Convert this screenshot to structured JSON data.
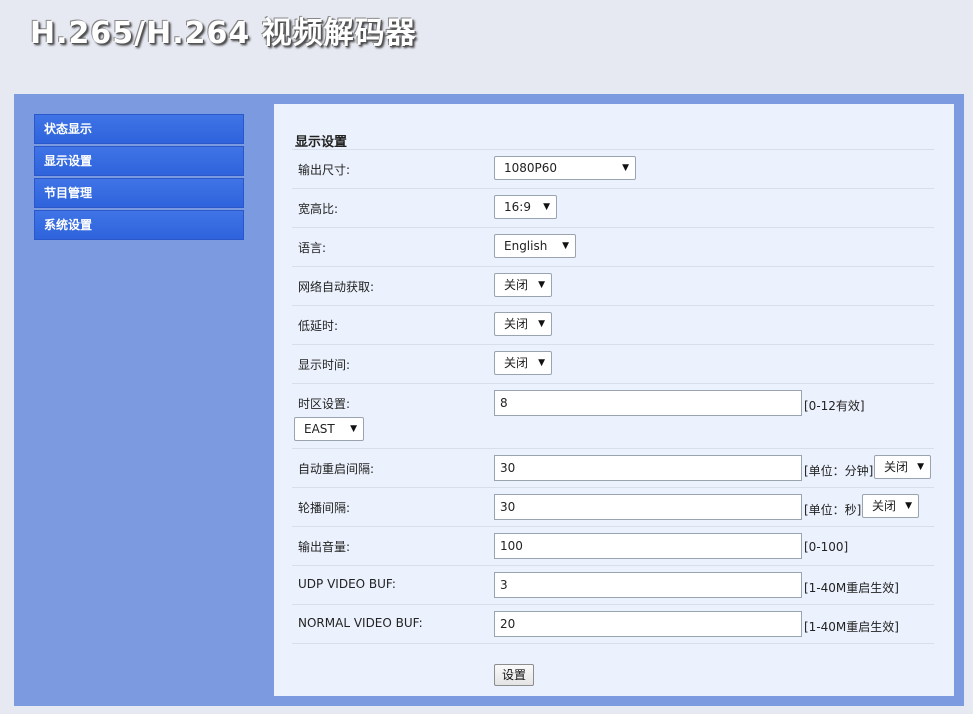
{
  "header": {
    "title": "H.265/H.264 视频解码器"
  },
  "sidebar": {
    "items": [
      {
        "label": "状态显示"
      },
      {
        "label": "显示设置"
      },
      {
        "label": "节目管理"
      },
      {
        "label": "系统设置"
      }
    ]
  },
  "panel": {
    "title": "显示设置",
    "fields": {
      "output_size": {
        "label": "输出尺寸:",
        "value": "1080P60"
      },
      "aspect_ratio": {
        "label": "宽高比:",
        "value": "16:9"
      },
      "language": {
        "label": "语言:",
        "value": "English"
      },
      "network_auto": {
        "label": "网络自动获取:",
        "value": "关闭"
      },
      "low_latency": {
        "label": "低延时:",
        "value": "关闭"
      },
      "show_time": {
        "label": "显示时间:",
        "value": "关闭"
      },
      "timezone": {
        "label": "时区设置:",
        "value": "8",
        "hint": "[0-12有效]",
        "direction": "EAST"
      },
      "auto_restart": {
        "label": "自动重启间隔:",
        "value": "30",
        "hint": "[单位：分钟]",
        "toggle": "关闭"
      },
      "carousel": {
        "label": "轮播间隔:",
        "value": "30",
        "hint": "[单位：秒]",
        "toggle": "关闭"
      },
      "volume": {
        "label": "输出音量:",
        "value": "100",
        "hint": "[0-100]"
      },
      "udp_buf": {
        "label": "UDP VIDEO BUF:",
        "value": "3",
        "hint": "[1-40M重启生效]"
      },
      "normal_buf": {
        "label": "NORMAL VIDEO BUF:",
        "value": "20",
        "hint": "[1-40M重启生效]"
      }
    },
    "submit_label": "设置"
  },
  "icons": {
    "dropdown": "dropdown-arrow-icon"
  },
  "colors": {
    "sidebar_item": "#2e63dc",
    "frame": "#7b9ae0",
    "panel": "#ecf2fd"
  }
}
